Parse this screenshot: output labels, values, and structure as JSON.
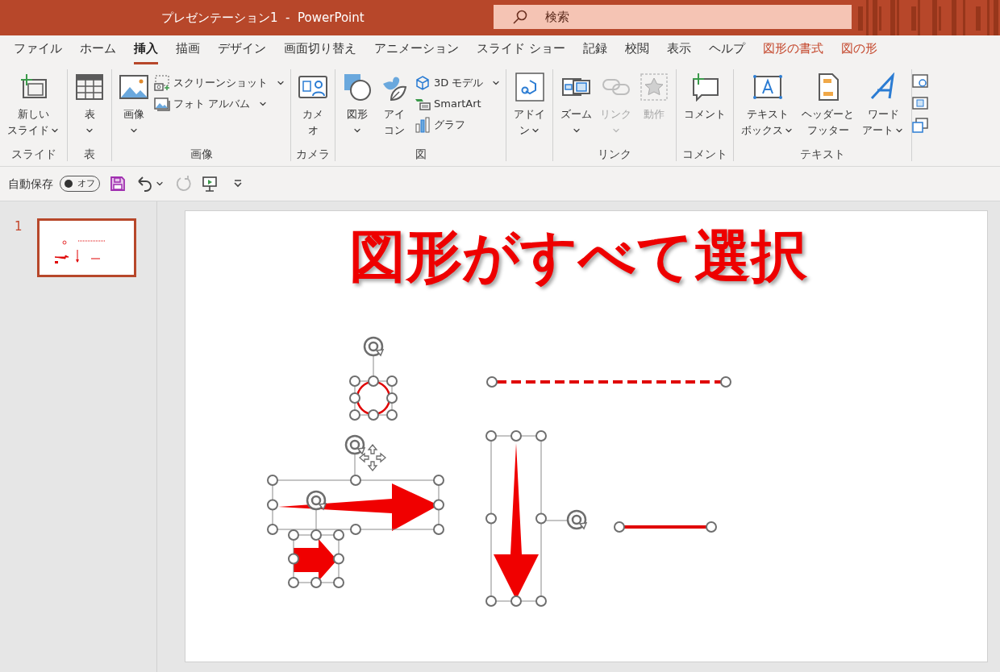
{
  "title_bar": {
    "title": "プレゼンテーション1  -  PowerPoint",
    "search_placeholder": "検索"
  },
  "tabs": [
    {
      "label": "ファイル",
      "selected": false,
      "kind": "normal"
    },
    {
      "label": "ホーム",
      "selected": false,
      "kind": "normal"
    },
    {
      "label": "挿入",
      "selected": true,
      "kind": "normal"
    },
    {
      "label": "描画",
      "selected": false,
      "kind": "normal"
    },
    {
      "label": "デザイン",
      "selected": false,
      "kind": "normal"
    },
    {
      "label": "画面切り替え",
      "selected": false,
      "kind": "normal"
    },
    {
      "label": "アニメーション",
      "selected": false,
      "kind": "normal"
    },
    {
      "label": "スライド ショー",
      "selected": false,
      "kind": "normal"
    },
    {
      "label": "記録",
      "selected": false,
      "kind": "normal"
    },
    {
      "label": "校閲",
      "selected": false,
      "kind": "normal"
    },
    {
      "label": "表示",
      "selected": false,
      "kind": "normal"
    },
    {
      "label": "ヘルプ",
      "selected": false,
      "kind": "normal"
    },
    {
      "label": "図形の書式",
      "selected": false,
      "kind": "contextual"
    },
    {
      "label": "図の形",
      "selected": false,
      "kind": "contextual"
    }
  ],
  "ribbon_groups": [
    {
      "label": "スライド",
      "items": [
        {
          "kind": "large",
          "lines": [
            "新しい",
            "スライド"
          ],
          "dropdown": true,
          "disabled": false
        }
      ]
    },
    {
      "label": "表",
      "items": [
        {
          "kind": "large",
          "lines": [
            "表"
          ],
          "dropdown": true,
          "disabled": false
        }
      ]
    },
    {
      "label": "画像",
      "items": [
        {
          "kind": "large",
          "lines": [
            "画像"
          ],
          "dropdown": true,
          "disabled": false
        },
        {
          "kind": "small",
          "lines": [
            "スクリーンショット"
          ],
          "dropdown": true,
          "disabled": false
        },
        {
          "kind": "small",
          "lines": [
            "フォト アルバム"
          ],
          "dropdown": true,
          "disabled": false
        }
      ]
    },
    {
      "label": "カメラ",
      "items": [
        {
          "kind": "large",
          "lines": [
            "カメ",
            "オ"
          ],
          "dropdown": false,
          "disabled": false
        }
      ]
    },
    {
      "label": "図",
      "items": [
        {
          "kind": "large",
          "lines": [
            "図形"
          ],
          "dropdown": true,
          "disabled": false
        },
        {
          "kind": "large",
          "lines": [
            "アイ",
            "コン"
          ],
          "dropdown": false,
          "disabled": false
        },
        {
          "kind": "small",
          "lines": [
            "3D モデル"
          ],
          "dropdown": true,
          "disabled": false
        },
        {
          "kind": "small",
          "lines": [
            "SmartArt"
          ],
          "dropdown": false,
          "disabled": false
        },
        {
          "kind": "small",
          "lines": [
            "グラフ"
          ],
          "dropdown": false,
          "disabled": false
        }
      ]
    },
    {
      "items": [
        {
          "kind": "large",
          "lines": [
            "アドイ",
            "ン"
          ],
          "dropdown": true,
          "disabled": false
        }
      ]
    },
    {
      "label": "リンク",
      "items": [
        {
          "kind": "large",
          "lines": [
            "ズーム"
          ],
          "dropdown": true,
          "disabled": false
        },
        {
          "kind": "large",
          "lines": [
            "リンク"
          ],
          "dropdown": true,
          "disabled": true
        },
        {
          "kind": "large",
          "lines": [
            "動作"
          ],
          "dropdown": false,
          "disabled": true
        }
      ]
    },
    {
      "label": "コメント",
      "items": [
        {
          "kind": "large",
          "lines": [
            "コメント"
          ],
          "dropdown": false,
          "disabled": false
        }
      ]
    },
    {
      "label": "テキスト",
      "items": [
        {
          "kind": "large",
          "lines": [
            "テキスト",
            "ボックス"
          ],
          "dropdown": true,
          "disabled": false
        },
        {
          "kind": "large",
          "lines": [
            "ヘッダーと",
            "フッター"
          ],
          "dropdown": false,
          "disabled": false
        },
        {
          "kind": "large",
          "lines": [
            "ワード",
            "アート"
          ],
          "dropdown": true,
          "disabled": false
        }
      ]
    }
  ],
  "quick_access": {
    "autosave_label": "自動保存",
    "autosave_toggle": {
      "label": "オフ",
      "on": false
    }
  },
  "slide_panel": {
    "slides": [
      {
        "number": "1",
        "selected": true
      }
    ]
  },
  "slide": {
    "title": "図形がすべて選択",
    "shapes": [
      {
        "kind": "circle",
        "selected": true
      },
      {
        "kind": "thin-arrow-right",
        "selected": true
      },
      {
        "kind": "block-arrow-right",
        "selected": true
      },
      {
        "kind": "dashed-line",
        "selected": true
      },
      {
        "kind": "thin-arrow-down",
        "selected": true
      },
      {
        "kind": "line",
        "selected": true
      }
    ]
  }
}
